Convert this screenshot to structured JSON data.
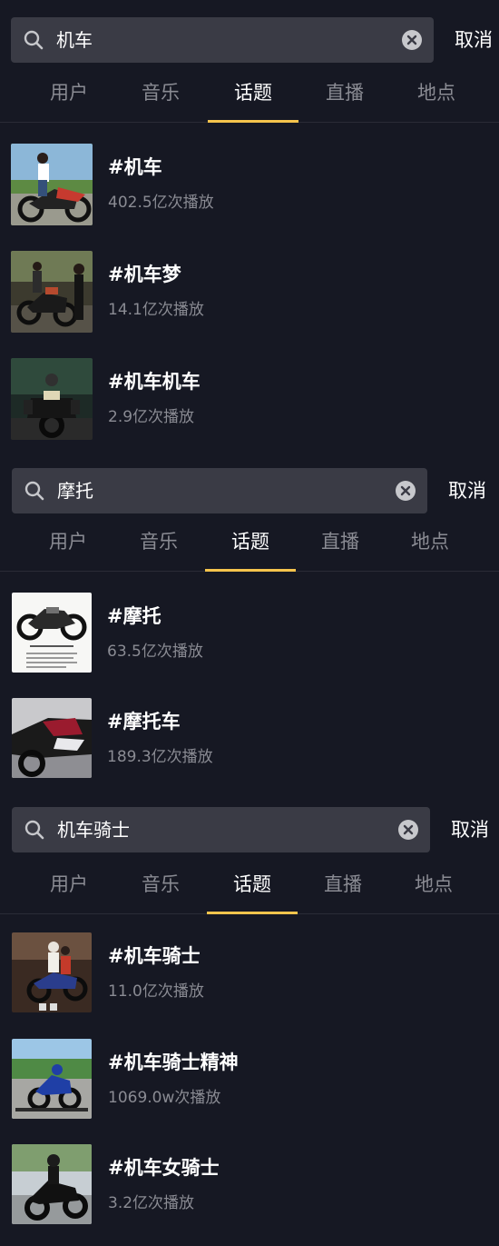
{
  "tabs": [
    "用户",
    "音乐",
    "话题",
    "直播",
    "地点"
  ],
  "active_tab": "话题",
  "cancel_label": "取消",
  "searches": [
    {
      "query": "机车",
      "results": [
        {
          "name": "#机车",
          "plays": "402.5亿次播放",
          "thumb": "rider-motorcycle-icon"
        },
        {
          "name": "#机车梦",
          "plays": "14.1亿次播放",
          "thumb": "motorcycle-group-icon"
        },
        {
          "name": "#机车机车",
          "plays": "2.9亿次播放",
          "thumb": "adventure-bike-icon"
        }
      ]
    },
    {
      "query": "摩托",
      "results": [
        {
          "name": "#摩托",
          "plays": "63.5亿次播放",
          "thumb": "motorcycle-spec-sheet-icon"
        },
        {
          "name": "#摩托车",
          "plays": "189.3亿次播放",
          "thumb": "red-sportbike-icon"
        }
      ]
    },
    {
      "query": "机车骑士",
      "results": [
        {
          "name": "#机车骑士",
          "plays": "11.0亿次播放",
          "thumb": "couple-on-motorcycle-icon"
        },
        {
          "name": "#机车骑士精神",
          "plays": "1069.0w次播放",
          "thumb": "racing-motorcycle-icon"
        },
        {
          "name": "#机车女骑士",
          "plays": "3.2亿次播放",
          "thumb": "female-rider-icon"
        }
      ]
    }
  ]
}
